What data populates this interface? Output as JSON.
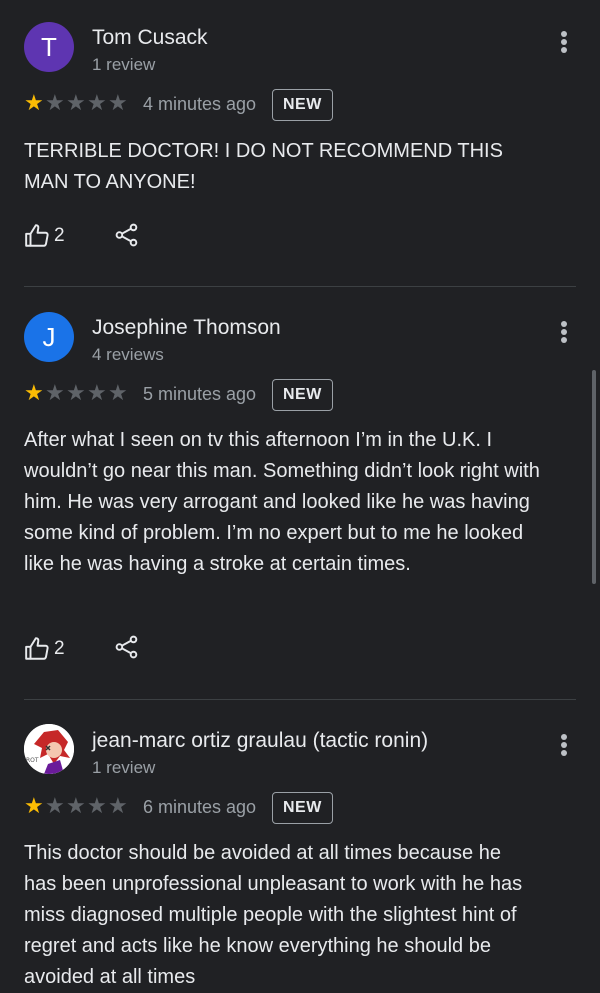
{
  "reviews": [
    {
      "name": "Tom Cusack",
      "avatar_letter": "T",
      "avatar_color": "#5e35b1",
      "count": "1 review",
      "rating": 1,
      "time": "4 minutes ago",
      "badge": "NEW",
      "text": "TERRIBLE DOCTOR! I DO NOT RECOMMEND THIS MAN TO ANYONE!",
      "likes": "2"
    },
    {
      "name": "Josephine Thomson",
      "avatar_letter": "J",
      "avatar_color": "#1a73e8",
      "count": "4 reviews",
      "rating": 1,
      "time": "5 minutes ago",
      "badge": "NEW",
      "text": "After what I seen on tv this afternoon I’m in the U.K. I wouldn’t go near this man. Something didn’t look right with him. He was very arrogant and looked like he was having some kind of problem. I’m no expert but to me he looked like he was having a stroke at certain times.",
      "likes": "2"
    },
    {
      "name": "jean-marc ortiz graulau (tactic ronin)",
      "avatar_letter": "",
      "avatar_color": "#ffffff",
      "count": "1 review",
      "rating": 1,
      "time": "6 minutes ago",
      "badge": "NEW",
      "text": "This doctor should be avoided at all times because he has been unprofessional unpleasant to work with he has miss diagnosed multiple people with the slightest hint of regret and acts like he know everything he should be avoided at all times"
    }
  ],
  "icons": {
    "star": "star-icon",
    "like": "thumbs-up-icon",
    "share": "share-icon",
    "menu": "more-vert-icon"
  },
  "colors": {
    "background": "#202124",
    "star_filled": "#fbbc04",
    "star_empty": "#5f6368"
  }
}
